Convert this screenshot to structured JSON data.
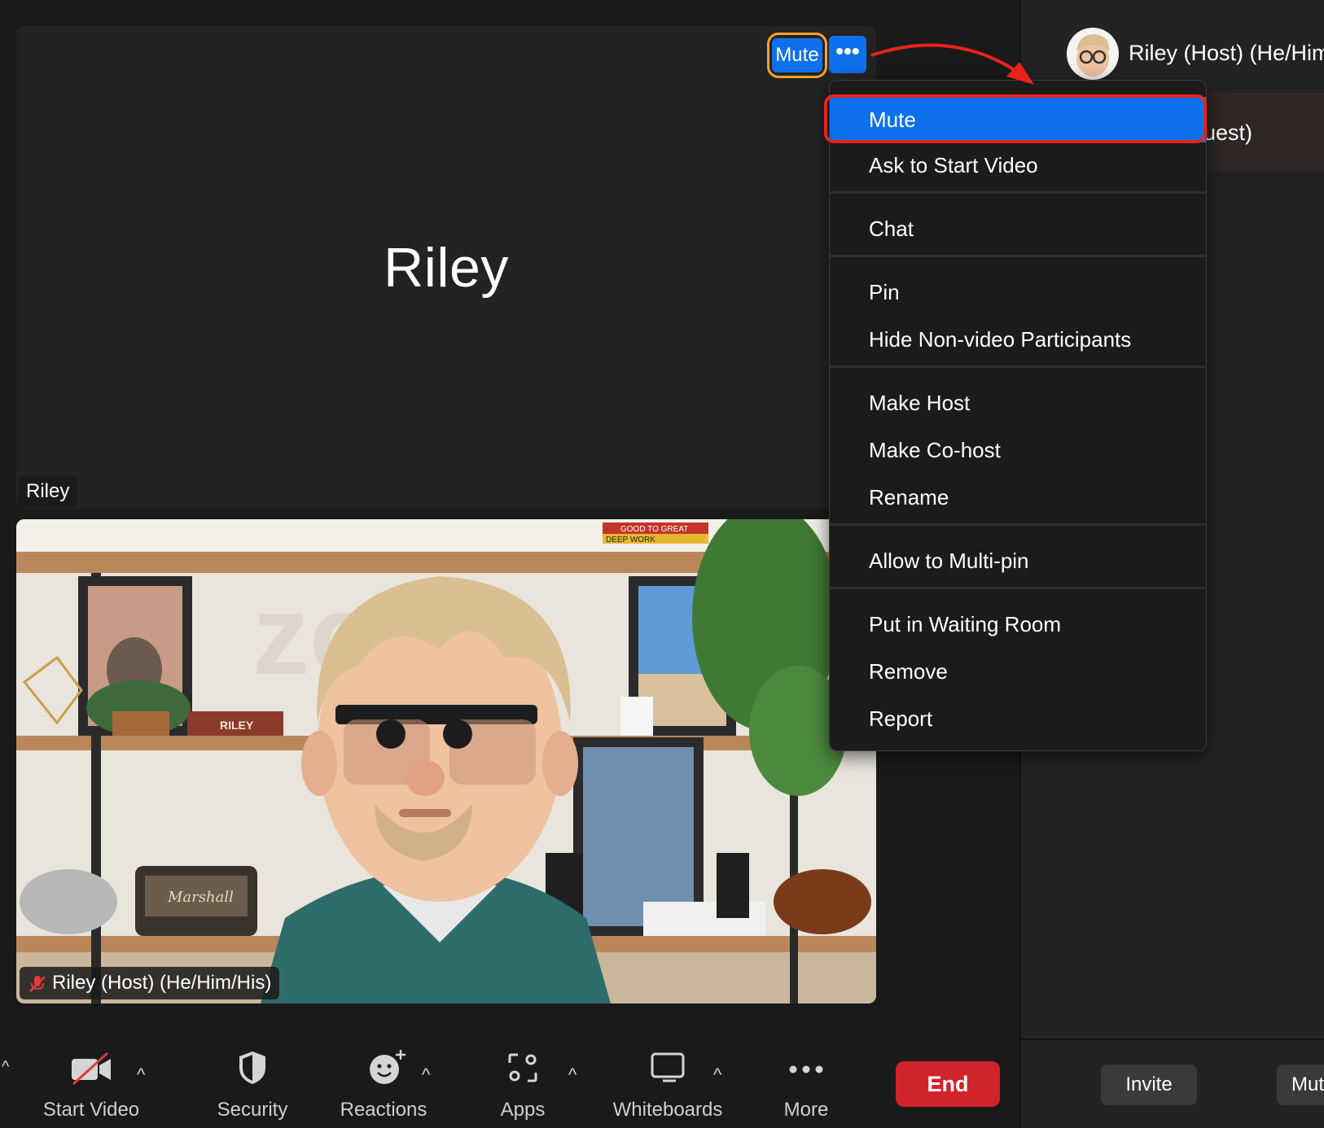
{
  "stage": {
    "big_name": "Riley",
    "tile_name": "Riley",
    "mute_label": "Mute",
    "more_label": "•••",
    "video_name": "Riley (Host) (He/Him/His)"
  },
  "right_panel": {
    "host_name": "Riley (Host) (He/Him",
    "guest_fragment": "uest)",
    "invite_label": "Invite",
    "mute_label": "Mut"
  },
  "context_menu": {
    "items": [
      {
        "label": "Mute",
        "selected": true
      },
      {
        "label": "Ask to Start Video"
      },
      {
        "label": "Chat"
      },
      {
        "label": "Pin"
      },
      {
        "label": "Hide Non-video Participants"
      },
      {
        "label": "Make Host"
      },
      {
        "label": "Make Co-host"
      },
      {
        "label": "Rename"
      },
      {
        "label": "Allow to Multi-pin"
      },
      {
        "label": "Put in Waiting Room"
      },
      {
        "label": "Remove"
      },
      {
        "label": "Report"
      }
    ]
  },
  "toolbar": {
    "start_video": "Start Video",
    "security": "Security",
    "reactions": "Reactions",
    "apps": "Apps",
    "whiteboards": "Whiteboards",
    "more": "More",
    "end": "End"
  },
  "scene": {
    "book_title": "GOOD TO GREAT",
    "book_title_2": "DEEP WORK",
    "nameplate": "RILEY",
    "speaker_brand": "Marshall"
  },
  "colors": {
    "accent_blue": "#0e71eb",
    "end_red": "#d0232a",
    "highlight_orange": "#f7a02a",
    "annotation_red": "#e8231b"
  }
}
